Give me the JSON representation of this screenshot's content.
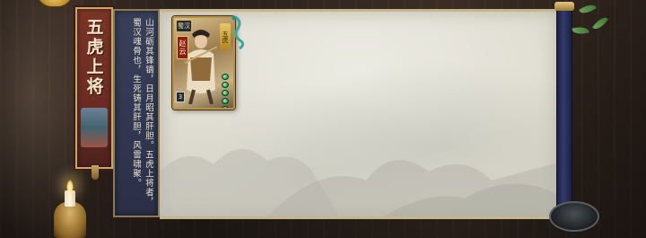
{
  "banner": {
    "title": "五虎上将"
  },
  "description": {
    "text": "山河砺其锋镝，日月昭其肝胆。五虎上将者，蜀汉魂骨也，生死铸其肝胆，风雷啸聚。"
  },
  "hero_card": {
    "name": "赵云",
    "faction": "蜀汉",
    "rank": "五虎",
    "level": "3",
    "hp": 5
  },
  "colors": {
    "banner_red": "#6a2c22",
    "desc_navy": "#2b3048",
    "parchment": "#e2e0d5",
    "gold_trim": "#c7a76a"
  },
  "icons": {
    "candle": "candle-icon",
    "inkstone": "inkstone-icon",
    "faction_badge": "faction-icon",
    "hp_pip": "health-pip-icon"
  }
}
